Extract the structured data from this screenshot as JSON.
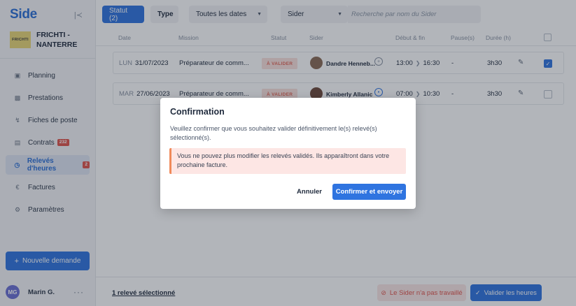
{
  "sidebar": {
    "logo": "Side",
    "collapse_icon": "collapse-left-icon",
    "org": {
      "logo_text": "FRICHTI",
      "name": "FRICHTI - NANTERRE"
    },
    "items": [
      {
        "label": "Planning",
        "icon": "calendar-icon"
      },
      {
        "label": "Prestations",
        "icon": "briefcase-icon"
      },
      {
        "label": "Fiches de poste",
        "icon": "bolt-icon"
      },
      {
        "label": "Contrats",
        "icon": "document-icon",
        "badge": "232"
      },
      {
        "label": "Relevés d'heures",
        "icon": "clock-icon",
        "badge": "2",
        "active": true
      },
      {
        "label": "Factures",
        "icon": "euro-icon"
      },
      {
        "label": "Paramètres",
        "icon": "gear-icon"
      }
    ],
    "new_request_label": "Nouvelle demande",
    "user": {
      "initials": "MG",
      "name": "Marin G.",
      "menu": "···"
    }
  },
  "filters": {
    "status_label": "Statut (2)",
    "type_label": "Type",
    "dates_label": "Toutes les dates",
    "sider_label": "Sider",
    "search_placeholder": "Recherche par nom du Sider"
  },
  "table": {
    "headers": [
      "Date",
      "Mission",
      "Statut",
      "Sider",
      "Début & fin",
      "Pause(s)",
      "Durée (h)"
    ],
    "rows": [
      {
        "day": "LUN",
        "date": "31/07/2023",
        "mission": "Préparateur de comm...",
        "status": "À VALIDER",
        "sider": "Dandre Henneb...",
        "start": "13:00",
        "end": "16:30",
        "pause": "-",
        "duration": "3h30",
        "checked": true
      },
      {
        "day": "MAR",
        "date": "27/06/2023",
        "mission": "Préparateur de comm...",
        "status": "À VALIDER",
        "sider": "Kimberly Allanic",
        "start": "07:00",
        "end": "10:30",
        "pause": "-",
        "duration": "3h30",
        "checked": false
      }
    ]
  },
  "bottom": {
    "selected_label": "1 relevé sélectionné",
    "noshow_label": "Le Sider n'a pas travaillé",
    "validate_label": "Valider les heures"
  },
  "modal": {
    "title": "Confirmation",
    "body": "Veuillez confirmer que vous souhaitez valider définitivement le(s) relevé(s) sélectionné(s).",
    "alert": "Vous ne pouvez plus modifier les relevés validés. Ils apparaîtront dans votre prochaine facture.",
    "cancel_label": "Annuler",
    "confirm_label": "Confirmer et envoyer"
  },
  "colors": {
    "accent": "#2f74e0",
    "danger": "#e0544b",
    "pending_bg": "#fbe1dc"
  }
}
